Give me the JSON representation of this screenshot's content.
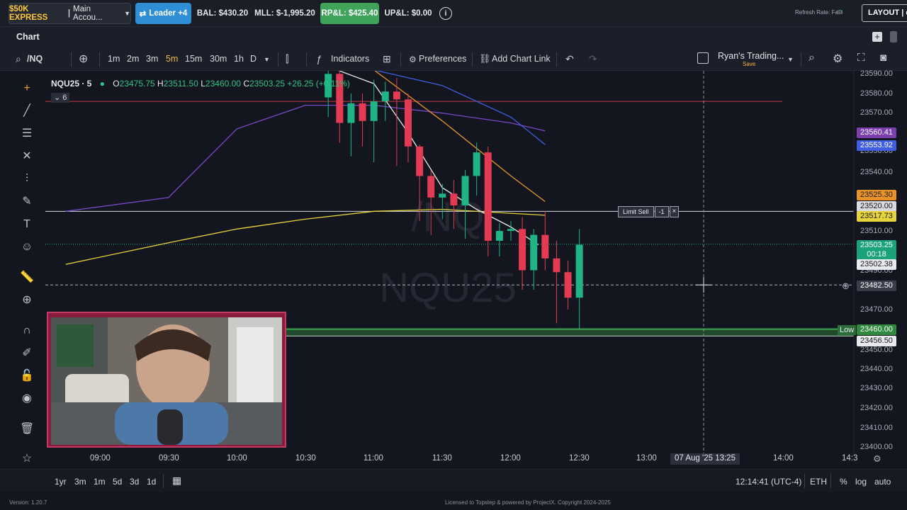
{
  "topbar": {
    "account_name": "$50K EXPRESS",
    "account_sep": "|",
    "account_sub": "Main Accou...",
    "leader": "Leader +4",
    "bal": "BAL: $430.20",
    "mll": "MLL: $-1,995.20",
    "rpl": "RP&L: $425.40",
    "upl": "UP&L: $0.00",
    "info_icon": "i",
    "refresh_rate": "Refresh Rate: Fast",
    "layout_btn": "LAYOUT | de"
  },
  "chart_header": {
    "title": "Chart",
    "add_icon": "+"
  },
  "toolbar": {
    "symbol": "/NQ",
    "intervals": [
      "1m",
      "2m",
      "3m",
      "5m",
      "15m",
      "30m",
      "1h",
      "D"
    ],
    "selected_interval": "5m",
    "indicators": "Indicators",
    "preferences": "Preferences",
    "add_chart_link": "Add Chart Link",
    "layout_name": "Ryan's Trading...",
    "layout_save": "Save"
  },
  "legend": {
    "symbol": "NQU25 · 5",
    "o_label": "O",
    "o": "23475.75",
    "h_label": "H",
    "h": "23511.50",
    "l_label": "L",
    "l": "23460.00",
    "c_label": "C",
    "c": "23503.25",
    "change": "+26.25 (+0.11%)",
    "collapsed_count": "6"
  },
  "watermark": {
    "line1": "/NQ",
    "line2": "NQU25"
  },
  "limit_order": {
    "label": "Limit Sell",
    "qty": "-1",
    "close": "×"
  },
  "price_axis": {
    "ticks": [
      "23590.00",
      "23580.00",
      "23570.00",
      "23550.00",
      "23540.00",
      "23510.00",
      "23490.00",
      "23470.00",
      "23450.00",
      "23440.00",
      "23430.00",
      "23420.00",
      "23410.00",
      "23400.00"
    ],
    "tags": [
      {
        "text": "23560.41",
        "bg": "#7b3fb0",
        "fg": "#ffffff"
      },
      {
        "text": "23553.92",
        "bg": "#3f5fe0",
        "fg": "#ffffff"
      },
      {
        "text": "23525.30",
        "bg": "#e8922a",
        "fg": "#1a1a1a"
      },
      {
        "text": "23520.00",
        "bg": "#d8dae0",
        "fg": "#1a1a1a"
      },
      {
        "text": "23517.73",
        "bg": "#e7d43a",
        "fg": "#1a1a1a"
      },
      {
        "text": "23503.25",
        "bg": "#1aa37a",
        "fg": "#ffffff"
      },
      {
        "text": "00:18",
        "bg": "#1aa37a",
        "fg": "#ffffff"
      },
      {
        "text": "23502.38",
        "bg": "#e8e9ec",
        "fg": "#1a1a1a"
      },
      {
        "text": "23482.50",
        "bg": "#3a3e4a",
        "fg": "#ffffff"
      },
      {
        "text": "23460.00",
        "bg": "#2f8a3e",
        "fg": "#ffffff"
      },
      {
        "text": "23456.50",
        "bg": "#e8e9ec",
        "fg": "#1a1a1a"
      }
    ],
    "low_label": "Low"
  },
  "time_axis": {
    "ticks": [
      "09:00",
      "09:30",
      "10:00",
      "10:30",
      "11:00",
      "11:30",
      "12:00",
      "12:30",
      "13:00",
      "14:00",
      "14:3"
    ],
    "crosshair_label": "07 Aug '25  13:25"
  },
  "bottombar": {
    "ranges": [
      "1yr",
      "3m",
      "1m",
      "5d",
      "3d",
      "1d"
    ],
    "clock": "12:14:41 (UTC-4)",
    "session": "ETH",
    "percent": "%",
    "log": "log",
    "auto": "auto"
  },
  "footer": {
    "version": "Version: 1.20.7",
    "license": "Licensed to Topstep & powered by ProjectX. Copyright 2024-2025"
  },
  "chart_data": {
    "type": "candlestick",
    "symbol": "NQU25",
    "interval": "5m",
    "ylim": [
      23400,
      23590
    ],
    "candles": [
      {
        "t": "10:40",
        "o": 23578,
        "h": 23592,
        "l": 23568,
        "c": 23590
      },
      {
        "t": "10:45",
        "o": 23590,
        "h": 23595,
        "l": 23555,
        "c": 23565
      },
      {
        "t": "10:50",
        "o": 23565,
        "h": 23580,
        "l": 23548,
        "c": 23575
      },
      {
        "t": "10:55",
        "o": 23575,
        "h": 23580,
        "l": 23553,
        "c": 23566
      },
      {
        "t": "11:00",
        "o": 23566,
        "h": 23587,
        "l": 23545,
        "c": 23576
      },
      {
        "t": "11:05",
        "o": 23576,
        "h": 23586,
        "l": 23566,
        "c": 23581
      },
      {
        "t": "11:10",
        "o": 23581,
        "h": 23588,
        "l": 23543,
        "c": 23577
      },
      {
        "t": "11:15",
        "o": 23577,
        "h": 23580,
        "l": 23545,
        "c": 23553
      },
      {
        "t": "11:20",
        "o": 23553,
        "h": 23554,
        "l": 23515,
        "c": 23538
      },
      {
        "t": "11:25",
        "o": 23538,
        "h": 23541,
        "l": 23508,
        "c": 23527
      },
      {
        "t": "11:30",
        "o": 23527,
        "h": 23534,
        "l": 23516,
        "c": 23529
      },
      {
        "t": "11:35",
        "o": 23529,
        "h": 23536,
        "l": 23511,
        "c": 23523
      },
      {
        "t": "11:40",
        "o": 23523,
        "h": 23541,
        "l": 23506,
        "c": 23538
      },
      {
        "t": "11:45",
        "o": 23538,
        "h": 23555,
        "l": 23528,
        "c": 23550
      },
      {
        "t": "11:50",
        "o": 23550,
        "h": 23553,
        "l": 23497,
        "c": 23505
      },
      {
        "t": "11:55",
        "o": 23505,
        "h": 23514,
        "l": 23497,
        "c": 23510
      },
      {
        "t": "12:00",
        "o": 23510,
        "h": 23515,
        "l": 23505,
        "c": 23511
      },
      {
        "t": "12:05",
        "o": 23511,
        "h": 23517,
        "l": 23480,
        "c": 23490
      },
      {
        "t": "12:10",
        "o": 23490,
        "h": 23511,
        "l": 23480,
        "c": 23508
      },
      {
        "t": "12:15",
        "o": 23508,
        "h": 23520,
        "l": 23490,
        "c": 23496
      },
      {
        "t": "12:20",
        "o": 23496,
        "h": 23505,
        "l": 23463,
        "c": 23489
      },
      {
        "t": "12:25",
        "o": 23489,
        "h": 23495,
        "l": 23470,
        "c": 23476
      },
      {
        "t": "12:30",
        "o": 23476,
        "h": 23511,
        "l": 23460,
        "c": 23503
      }
    ],
    "horizontal_lines": [
      {
        "price": 23576,
        "color": "#c0394a"
      },
      {
        "price": 23520,
        "color": "#d8dae0"
      },
      {
        "price": 23503.25,
        "color": "#1aa37a"
      },
      {
        "price": 23482.5,
        "color": "#a9adb8"
      },
      {
        "price": 23460,
        "color": "#3aa84a"
      },
      {
        "price": 23456.5,
        "color": "#d8dae0"
      }
    ],
    "moving_averages": [
      {
        "color": "#7a49c8",
        "points": [
          [
            8.75,
            23520
          ],
          [
            9.5,
            23527
          ],
          [
            10.0,
            23562
          ],
          [
            10.5,
            23574
          ],
          [
            11.0,
            23574
          ],
          [
            11.5,
            23570
          ],
          [
            12.0,
            23565
          ],
          [
            12.25,
            23561
          ]
        ]
      },
      {
        "color": "#3f5fe0",
        "points": [
          [
            10.5,
            23598
          ],
          [
            11.0,
            23592
          ],
          [
            11.5,
            23584
          ],
          [
            12.0,
            23568
          ],
          [
            12.25,
            23554
          ]
        ]
      },
      {
        "color": "#e8922a",
        "points": [
          [
            11.0,
            23592
          ],
          [
            11.5,
            23566
          ],
          [
            12.0,
            23538
          ],
          [
            12.25,
            23525
          ]
        ]
      },
      {
        "color": "#e7d43a",
        "points": [
          [
            8.75,
            23493
          ],
          [
            9.5,
            23504
          ],
          [
            10.0,
            23511
          ],
          [
            10.5,
            23516
          ],
          [
            11.0,
            23520
          ],
          [
            11.5,
            23521
          ],
          [
            12.0,
            23519
          ],
          [
            12.25,
            23518
          ]
        ]
      },
      {
        "color": "#e8e9ec",
        "points": [
          [
            10.5,
            23598
          ],
          [
            11.0,
            23585
          ],
          [
            11.25,
            23560
          ],
          [
            11.5,
            23532
          ],
          [
            11.75,
            23521
          ],
          [
            12.0,
            23512
          ],
          [
            12.2,
            23503
          ]
        ]
      }
    ]
  }
}
